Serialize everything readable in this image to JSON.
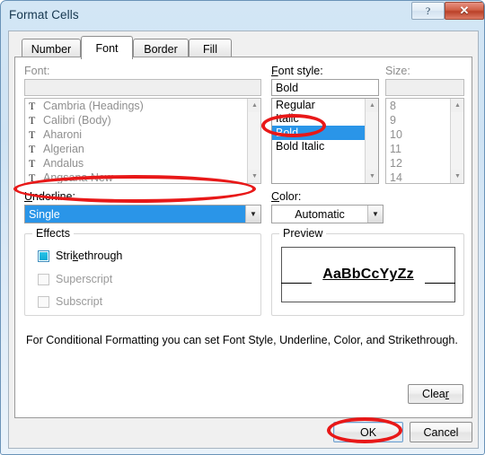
{
  "window": {
    "title": "Format Cells",
    "help_button": "?",
    "close_button": "✕"
  },
  "tabs": [
    {
      "label": "Number",
      "active": false
    },
    {
      "label": "Font",
      "active": true
    },
    {
      "label": "Border",
      "active": false
    },
    {
      "label": "Fill",
      "active": false
    }
  ],
  "font_section": {
    "label": "Font:",
    "input_value": "",
    "items": [
      "Cambria (Headings)",
      "Calibri (Body)",
      "Aharoni",
      "Algerian",
      "Andalus",
      "Angsana New"
    ],
    "icon": "truetype-icon",
    "disabled": true
  },
  "font_style_section": {
    "label": "Font style:",
    "input_value": "Bold",
    "items": [
      "Regular",
      "Italic",
      "Bold",
      "Bold Italic"
    ],
    "selected": "Bold"
  },
  "size_section": {
    "label": "Size:",
    "input_value": "",
    "items": [
      "8",
      "9",
      "10",
      "11",
      "12",
      "14"
    ],
    "disabled": true
  },
  "underline_section": {
    "label": "Underline:",
    "value": "Single"
  },
  "color_section": {
    "label": "Color:",
    "value": "Automatic"
  },
  "effects_section": {
    "title": "Effects",
    "items": [
      {
        "label": "Strikethrough",
        "state": "indeterminate",
        "disabled": false,
        "accel": "k"
      },
      {
        "label": "Superscript",
        "state": "unchecked",
        "disabled": true
      },
      {
        "label": "Subscript",
        "state": "unchecked",
        "disabled": true
      }
    ]
  },
  "preview_section": {
    "title": "Preview",
    "sample_text": "AaBbCcYyZz"
  },
  "note": "For Conditional Formatting you can set Font Style, Underline, Color, and Strikethrough.",
  "buttons": {
    "clear": "Clear",
    "ok": "OK",
    "cancel": "Cancel"
  },
  "annotations": {
    "accent_color": "#e81818",
    "targets": [
      "font-style-bold-item",
      "underline-combo",
      "ok-button"
    ]
  },
  "colors": {
    "selection_blue": "#2a95e8",
    "titlebar_blue": "#d3e6f5",
    "close_red": "#ba4129"
  }
}
